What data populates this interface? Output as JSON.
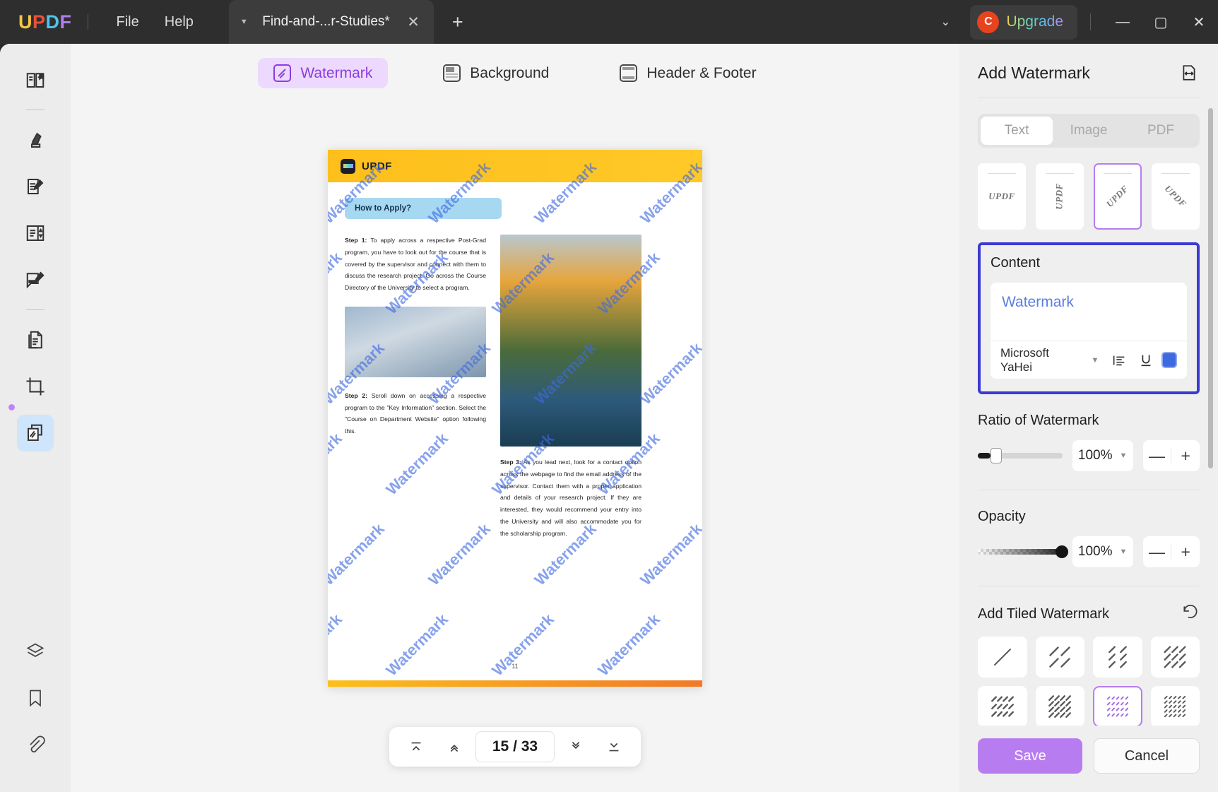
{
  "titlebar": {
    "logo_letters": [
      "U",
      "P",
      "D",
      "F"
    ],
    "menus": [
      {
        "label": "File",
        "name": "menu-file"
      },
      {
        "label": "Help",
        "name": "menu-help"
      }
    ],
    "tab": {
      "title": "Find-and-...r-Studies*",
      "caret": "▼",
      "close": "✕"
    },
    "new_tab": "+",
    "chevron": "⌄",
    "upgrade": {
      "badge": "C",
      "label": "Upgrade"
    },
    "window": {
      "minimize": "—",
      "maximize": "▢",
      "close": "✕"
    }
  },
  "rail": {
    "items": [
      {
        "name": "sidebar-item-reader",
        "icon": "reader-icon",
        "active": false
      },
      {
        "name": "sidebar-item-annotate",
        "icon": "highlighter-icon",
        "active": false
      },
      {
        "name": "sidebar-item-edit-pdf",
        "icon": "edit-document-icon",
        "active": false
      },
      {
        "name": "sidebar-item-ocr",
        "icon": "ocr-icon",
        "active": false
      },
      {
        "name": "sidebar-item-comment",
        "icon": "comment-edit-icon",
        "active": false
      },
      {
        "name": "sidebar-item-organize-pages",
        "icon": "pages-icon",
        "active": false
      },
      {
        "name": "sidebar-item-crop",
        "icon": "crop-icon",
        "active": false
      },
      {
        "name": "sidebar-item-watermark",
        "icon": "watermark-icon",
        "active": true
      }
    ],
    "bottom_items": [
      {
        "name": "sidebar-item-layers",
        "icon": "layers-icon"
      },
      {
        "name": "sidebar-item-bookmarks",
        "icon": "bookmark-icon"
      },
      {
        "name": "sidebar-item-attachments",
        "icon": "attachment-icon"
      }
    ]
  },
  "mode_tabs": [
    {
      "label": "Watermark",
      "icon": "watermark-icon",
      "active": true
    },
    {
      "label": "Background",
      "icon": "background-icon",
      "active": false
    },
    {
      "label": "Header & Footer",
      "icon": "header-footer-icon",
      "active": false
    }
  ],
  "document": {
    "brand": "UPDF",
    "heading_pill": "How to Apply?",
    "step1_label": "Step 1:",
    "step1_text": " To apply across a respective Post-Grad program, you have to look out for the course that is covered by the supervisor and connect with them to discuss the research project. Go across the Course Directory of the University to select a program.",
    "step2_label": "Step 2:",
    "step2_text": " Scroll down on accessing a respective program to the \"Key Information\" section. Select the \"Course on Department Website\" option following this.",
    "step3_label": "Step 3:",
    "step3_text": " As you lead next, look for a contact option across the webpage to find the email address of the supervisor. Contact them with a proper application and details of your research project. If they are interested, they would recommend your entry into the University and will also accommodate you for the scholarship program.",
    "page_number": "11",
    "watermark_text": "Watermark",
    "watermark_color": "#3e6ae1"
  },
  "pagenav": {
    "first": "⤒",
    "prev": "⌃",
    "value": "15 / 33",
    "next": "⌄",
    "last": "⤓"
  },
  "panel": {
    "title": "Add Watermark",
    "expand_icon": "fit-width-icon",
    "tabs": [
      {
        "label": "Text",
        "active": true
      },
      {
        "label": "Image",
        "active": false
      },
      {
        "label": "PDF",
        "active": false
      }
    ],
    "presets": [
      {
        "label": "UPDF",
        "rotation": "0",
        "selected": false
      },
      {
        "label": "UPDF",
        "rotation": "-90",
        "selected": false
      },
      {
        "label": "UPDF",
        "rotation": "-45",
        "selected": true
      },
      {
        "label": "UPDF",
        "rotation": "45",
        "selected": false
      }
    ],
    "content": {
      "label": "Content",
      "value": "Watermark",
      "font_name": "Microsoft YaHei",
      "align_icon": "align-left-icon",
      "underline_icon": "underline-icon",
      "color_swatch": "#3e6ae1",
      "highlight_color": "#3b3bd4"
    },
    "ratio": {
      "label": "Ratio of Watermark",
      "value": "100%",
      "slider_percent": 14,
      "minus": "—",
      "plus": "+"
    },
    "opacity": {
      "label": "Opacity",
      "value": "100%",
      "slider_percent": 100,
      "minus": "—",
      "plus": "+"
    },
    "tiled": {
      "label": "Add Tiled Watermark",
      "reset_icon": "reset-icon",
      "options": [
        {
          "name": "tile-1x1",
          "cols": 1,
          "rows": 1,
          "selected": false,
          "dot": false
        },
        {
          "name": "tile-2x2",
          "cols": 2,
          "rows": 2,
          "selected": false,
          "dot": false
        },
        {
          "name": "tile-2x3",
          "cols": 2,
          "rows": 3,
          "selected": false,
          "dot": false
        },
        {
          "name": "tile-3x3",
          "cols": 3,
          "rows": 3,
          "selected": false,
          "dot": false
        },
        {
          "name": "tile-4x3",
          "cols": 4,
          "rows": 3,
          "selected": false,
          "dot": false
        },
        {
          "name": "tile-4x4",
          "cols": 4,
          "rows": 4,
          "selected": false,
          "dot": false
        },
        {
          "name": "tile-5x4",
          "cols": 5,
          "rows": 4,
          "selected": true,
          "dot": true
        },
        {
          "name": "tile-5x5",
          "cols": 5,
          "rows": 5,
          "selected": false,
          "dot": true
        }
      ]
    },
    "save_label": "Save",
    "cancel_label": "Cancel",
    "accent": "#b77cf0"
  }
}
